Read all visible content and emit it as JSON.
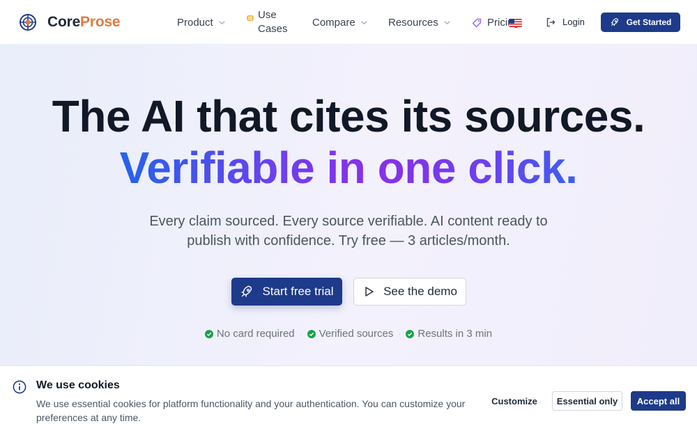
{
  "brand": {
    "part1": "Core",
    "part2": "Prose"
  },
  "nav": {
    "product": "Product",
    "use_cases": "Use Cases",
    "compare": "Compare",
    "resources": "Resources",
    "pricing": "Pricing",
    "login": "Login",
    "get_started": "Get Started"
  },
  "hero": {
    "headline": "The AI that cites its sources.",
    "highlight": "Verifiable in one click.",
    "subtitle": "Every claim sourced. Every source verifiable. AI content ready to publish with confidence. Try free — 3 articles/month.",
    "primary_cta": "Start free trial",
    "secondary_cta": "See the demo",
    "trust": [
      "No card required",
      "Verified sources",
      "Results in 3 min"
    ]
  },
  "cookie": {
    "title": "We use cookies",
    "text": "We use essential cookies for platform functionality and your authentication. You can customize your preferences at any time.",
    "customize": "Customize",
    "essential_only": "Essential only",
    "accept_all": "Accept all"
  },
  "colors": {
    "primary": "#1e3a8a",
    "brand_accent": "#e07a3f",
    "check_green": "#16a34a",
    "gradient_start": "#2563eb",
    "gradient_mid": "#8b2fe8"
  },
  "icons": [
    "crosshair-logo-icon",
    "chevron-down-icon",
    "use-cases-icon",
    "tag-icon",
    "us-flag-icon",
    "login-icon",
    "rocket-icon",
    "play-icon",
    "check-circle-icon",
    "info-icon"
  ]
}
